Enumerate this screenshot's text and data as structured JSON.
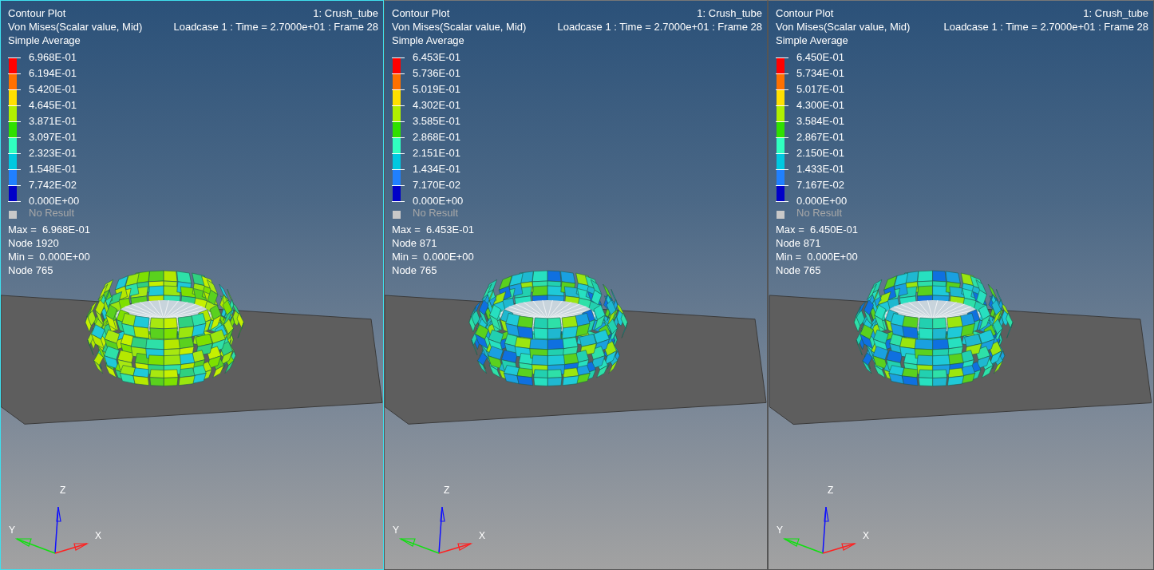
{
  "viewports": [
    {
      "selected": true,
      "title": "Contour Plot",
      "result": "Von Mises(Scalar value, Mid)",
      "averaging": "Simple Average",
      "model": "1: Crush_tube",
      "loadcase": "Loadcase 1 : Time = 2.7000e+01 : Frame 28",
      "legend": {
        "labels": [
          "6.968E-01",
          "6.194E-01",
          "5.420E-01",
          "4.645E-01",
          "3.871E-01",
          "3.097E-01",
          "2.323E-01",
          "1.548E-01",
          "7.742E-02",
          "0.000E+00"
        ],
        "bands": [
          {
            "color": "#ff0000"
          },
          {
            "color": "#ff7000"
          },
          {
            "color": "#ffe000"
          },
          {
            "color": "#b0f000"
          },
          {
            "color": "#30e000"
          },
          {
            "color": "#30ffc0"
          },
          {
            "color": "#00c8e0"
          },
          {
            "color": "#2080ff"
          },
          {
            "color": "#0000c8"
          }
        ],
        "no_result": "No Result"
      },
      "max_label": "Max =",
      "max_value": "6.968E-01",
      "max_node": "Node 1920",
      "min_label": "Min =",
      "min_value": "0.000E+00",
      "min_node": "Node 765",
      "axes": [
        {
          "label": "Z"
        },
        {
          "label": "Y"
        },
        {
          "label": "X"
        }
      ]
    },
    {
      "selected": false,
      "title": "Contour Plot",
      "result": "Von Mises(Scalar value, Mid)",
      "averaging": "Simple Average",
      "model": "1: Crush_tube",
      "loadcase": "Loadcase 1 : Time = 2.7000e+01 : Frame 28",
      "legend": {
        "labels": [
          "6.453E-01",
          "5.736E-01",
          "5.019E-01",
          "4.302E-01",
          "3.585E-01",
          "2.868E-01",
          "2.151E-01",
          "1.434E-01",
          "7.170E-02",
          "0.000E+00"
        ],
        "bands": [
          {
            "color": "#ff0000"
          },
          {
            "color": "#ff7000"
          },
          {
            "color": "#ffe000"
          },
          {
            "color": "#b0f000"
          },
          {
            "color": "#30e000"
          },
          {
            "color": "#30ffc0"
          },
          {
            "color": "#00c8e0"
          },
          {
            "color": "#2080ff"
          },
          {
            "color": "#0000c8"
          }
        ],
        "no_result": "No Result"
      },
      "max_label": "Max =",
      "max_value": "6.453E-01",
      "max_node": "Node 871",
      "min_label": "Min =",
      "min_value": "0.000E+00",
      "min_node": "Node 765",
      "axes": [
        {
          "label": "Z"
        },
        {
          "label": "Y"
        },
        {
          "label": "X"
        }
      ]
    },
    {
      "selected": false,
      "title": "Contour Plot",
      "result": "Von Mises(Scalar value, Mid)",
      "averaging": "Simple Average",
      "model": "1: Crush_tube",
      "loadcase": "Loadcase 1 : Time = 2.7000e+01 : Frame 28",
      "legend": {
        "labels": [
          "6.450E-01",
          "5.734E-01",
          "5.017E-01",
          "4.300E-01",
          "3.584E-01",
          "2.867E-01",
          "2.150E-01",
          "1.433E-01",
          "7.167E-02",
          "0.000E+00"
        ],
        "bands": [
          {
            "color": "#ff0000"
          },
          {
            "color": "#ff7000"
          },
          {
            "color": "#ffe000"
          },
          {
            "color": "#b0f000"
          },
          {
            "color": "#30e000"
          },
          {
            "color": "#30ffc0"
          },
          {
            "color": "#00c8e0"
          },
          {
            "color": "#2080ff"
          },
          {
            "color": "#0000c8"
          }
        ],
        "no_result": "No Result"
      },
      "max_label": "Max =",
      "max_value": "6.450E-01",
      "max_node": "Node 871",
      "min_label": "Min =",
      "min_value": "0.000E+00",
      "min_node": "Node 765",
      "axes": [
        {
          "label": "Z"
        },
        {
          "label": "Y"
        },
        {
          "label": "X"
        }
      ]
    }
  ]
}
